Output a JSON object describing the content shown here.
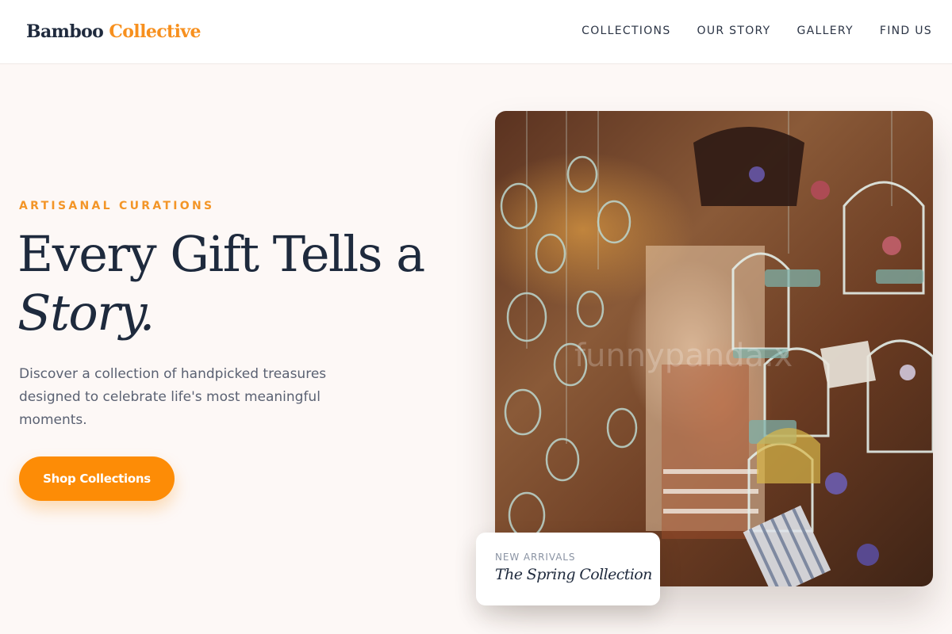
{
  "brand": {
    "name_part1": "Bamboo",
    "name_part2": "Collective"
  },
  "nav": {
    "items": [
      {
        "label": "COLLECTIONS"
      },
      {
        "label": "OUR STORY"
      },
      {
        "label": "GALLERY"
      },
      {
        "label": "FIND US"
      }
    ]
  },
  "hero": {
    "eyebrow": "ARTISANAL CURATIONS",
    "headline_line1": "Every Gift Tells a",
    "headline_line2": "Story.",
    "description": "Discover a collection of handpicked treasures designed to celebrate life's most meaningful moments.",
    "cta_label": "Shop Collections"
  },
  "feature_card": {
    "label": "NEW ARRIVALS",
    "title": "The Spring Collection"
  },
  "photo": {
    "subject": "hanging decorative birdcages in a gift shop",
    "watermark": "funnypanda.x"
  },
  "colors": {
    "accent": "#f7901e",
    "cta_background": "#fd8c06",
    "page_background": "#fdf8f6",
    "heading": "#1f2a3d"
  }
}
